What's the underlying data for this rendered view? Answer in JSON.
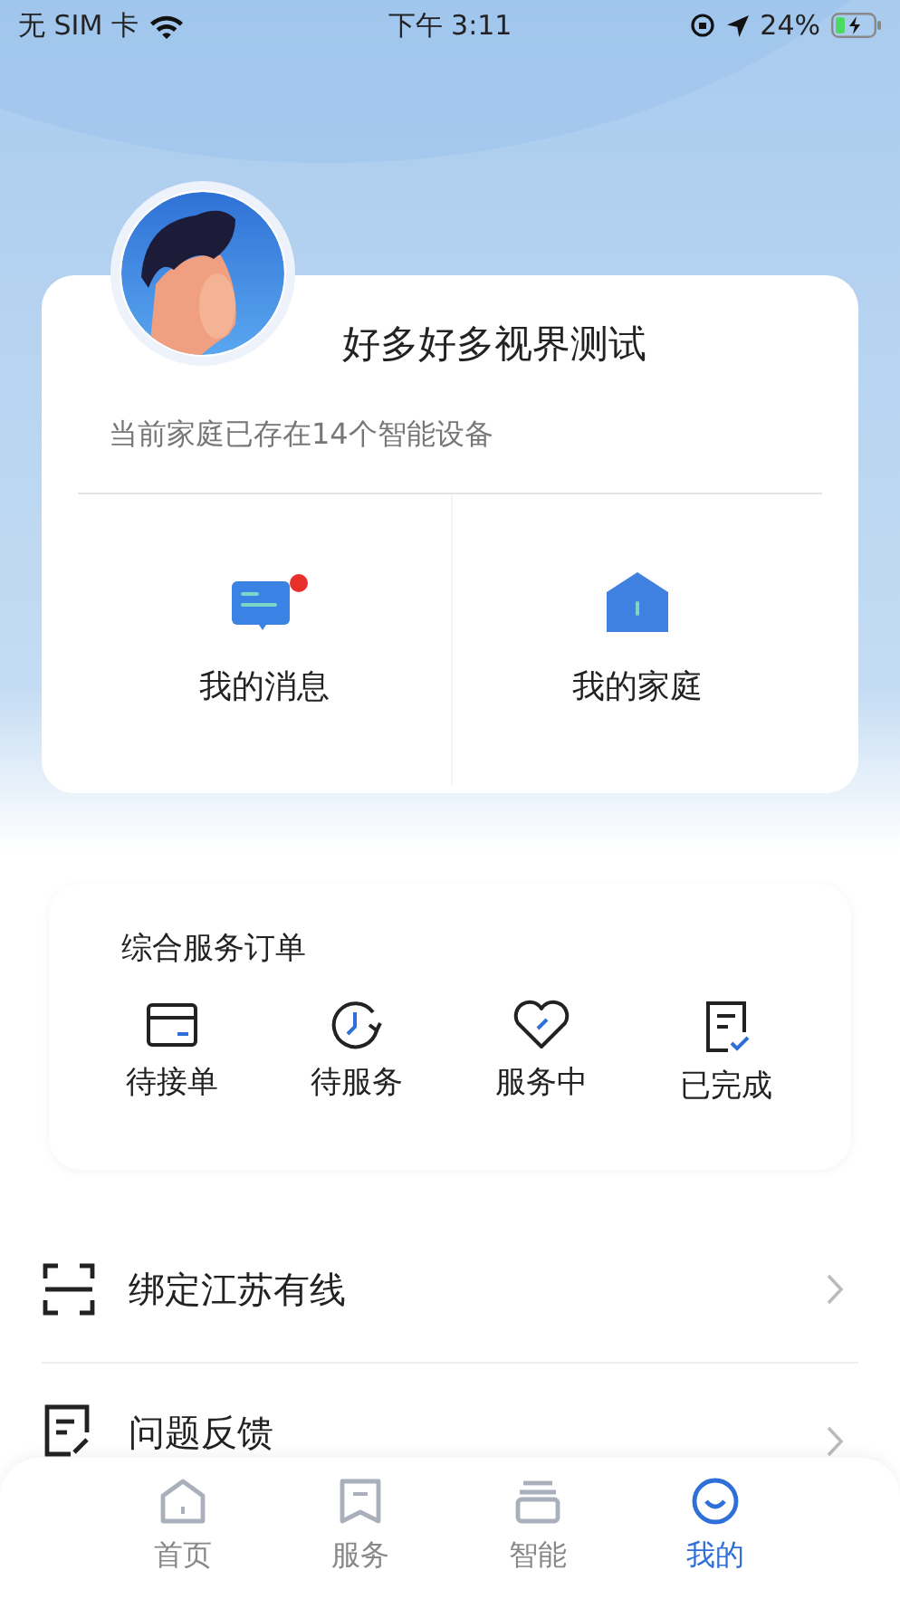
{
  "status_bar": {
    "carrier": "无 SIM 卡",
    "time": "下午 3:11",
    "battery": "24%"
  },
  "profile": {
    "name": "好多好多视界测试",
    "subtitle": "当前家庭已存在14个智能设备",
    "tiles": [
      {
        "label": "我的消息",
        "badge": true
      },
      {
        "label": "我的家庭",
        "badge": false
      }
    ]
  },
  "orders": {
    "title": "综合服务订单",
    "items": [
      "待接单",
      "待服务",
      "服务中",
      "已完成"
    ]
  },
  "menu": [
    "绑定江苏有线",
    "问题反馈"
  ],
  "tab_bar": [
    {
      "label": "首页",
      "selected": false
    },
    {
      "label": "服务",
      "selected": false
    },
    {
      "label": "智能",
      "selected": false
    },
    {
      "label": "我的",
      "selected": true
    }
  ]
}
